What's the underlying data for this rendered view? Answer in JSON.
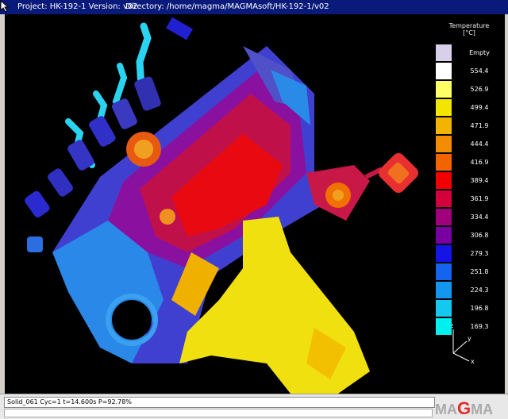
{
  "titlebar": {
    "project": "Project: HK-192-1 Version: v02",
    "directory": "Directory: /home/magma/MAGMAsoft/HK-192-1/v02"
  },
  "legend": {
    "title_line1": "Temperature",
    "title_line2": "[°C]",
    "entries": [
      {
        "label": "Empty",
        "color": "#d8d0ea"
      },
      {
        "label": "554.4",
        "color": "#ffffff"
      },
      {
        "label": "526.9",
        "color": "#ffff66"
      },
      {
        "label": "499.4",
        "color": "#f2e600"
      },
      {
        "label": "471.9",
        "color": "#f2b400"
      },
      {
        "label": "444.4",
        "color": "#f28c00"
      },
      {
        "label": "416.9",
        "color": "#f26400"
      },
      {
        "label": "389.4",
        "color": "#f20000"
      },
      {
        "label": "361.9",
        "color": "#d4003c"
      },
      {
        "label": "334.4",
        "color": "#a0007c"
      },
      {
        "label": "306.8",
        "color": "#7800a0"
      },
      {
        "label": "279.3",
        "color": "#1414e6"
      },
      {
        "label": "251.8",
        "color": "#1464f0"
      },
      {
        "label": "224.3",
        "color": "#1496f0"
      },
      {
        "label": "196.8",
        "color": "#14c8f0"
      },
      {
        "label": "169.3",
        "color": "#00f0f0"
      }
    ]
  },
  "axes": {
    "z": "z",
    "y": "y",
    "x": "x"
  },
  "status": {
    "line1": "Solid_061 Cyc=1 t=14.600s P=92.78%"
  },
  "logo": {
    "pre": "MA",
    "g": "G",
    "post": "MA"
  }
}
